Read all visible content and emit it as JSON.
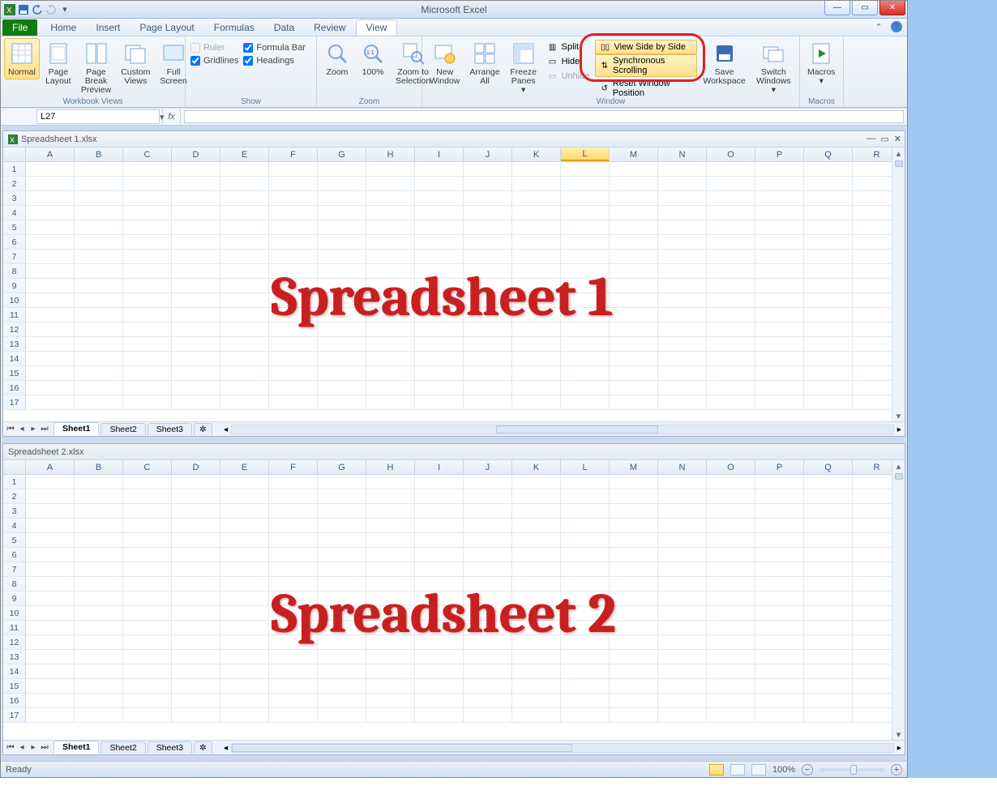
{
  "app": {
    "title": "Microsoft Excel"
  },
  "tabs": {
    "file": "File",
    "items": [
      "Home",
      "Insert",
      "Page Layout",
      "Formulas",
      "Data",
      "Review",
      "View"
    ],
    "active": "View"
  },
  "ribbon": {
    "views": {
      "normal": "Normal",
      "pageLayout": "Page\nLayout",
      "pageBreak": "Page Break\nPreview",
      "custom": "Custom\nViews",
      "full": "Full\nScreen",
      "groupLabel": "Workbook Views"
    },
    "show": {
      "ruler": "Ruler",
      "formulaBar": "Formula Bar",
      "gridlines": "Gridlines",
      "headings": "Headings",
      "groupLabel": "Show"
    },
    "zoom": {
      "zoom": "Zoom",
      "hundred": "100%",
      "toSelection": "Zoom to\nSelection",
      "groupLabel": "Zoom"
    },
    "window": {
      "new": "New\nWindow",
      "arrange": "Arrange\nAll",
      "freeze": "Freeze\nPanes",
      "split": "Split",
      "hide": "Hide",
      "unhide": "Unhide",
      "sideBySide": "View Side by Side",
      "syncScroll": "Synchronous Scrolling",
      "resetPos": "Reset Window Position",
      "save": "Save\nWorkspace",
      "switch": "Switch\nWindows",
      "groupLabel": "Window"
    },
    "macros": {
      "macros": "Macros",
      "groupLabel": "Macros"
    }
  },
  "namebox": "L27",
  "columns": [
    "A",
    "B",
    "C",
    "D",
    "E",
    "F",
    "G",
    "H",
    "I",
    "J",
    "K",
    "L",
    "M",
    "N",
    "O",
    "P",
    "Q",
    "R"
  ],
  "rows": [
    "1",
    "2",
    "3",
    "4",
    "5",
    "6",
    "7",
    "8",
    "9",
    "10",
    "11",
    "12",
    "13",
    "14",
    "15",
    "16",
    "17"
  ],
  "doc1": {
    "title": "Spreadsheet 1.xlsx",
    "overlay": "Spreadsheet 1",
    "activeCol": "L"
  },
  "doc2": {
    "title": "Spreadsheet 2.xlsx",
    "overlay": "Spreadsheet 2"
  },
  "sheets": {
    "s1": "Sheet1",
    "s2": "Sheet2",
    "s3": "Sheet3"
  },
  "status": {
    "ready": "Ready",
    "zoom": "100%"
  }
}
